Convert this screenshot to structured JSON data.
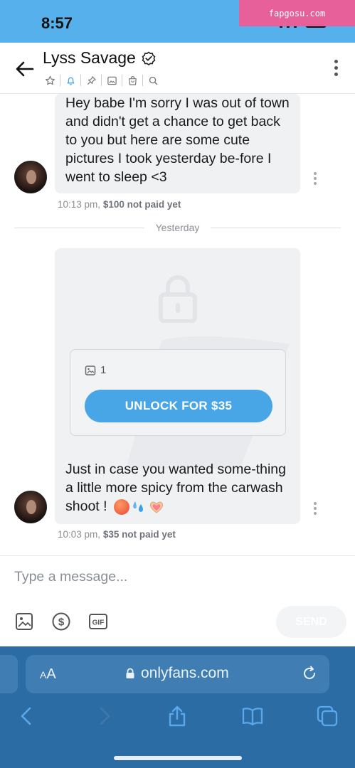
{
  "status_bar": {
    "time": "8:57",
    "battery_label": "",
    "watermark": "fapgosu.com"
  },
  "header": {
    "name": "Lyss Savage",
    "verified": true
  },
  "messages": [
    {
      "text": "Hey babe I'm sorry I was out of town and didn't get a chance to get back to you but here are some cute pictures I took yesterday be-fore I went to sleep <3",
      "time": "10:13 pm,",
      "price_status": "$100 not paid yet"
    }
  ],
  "date_divider": "Yesterday",
  "media_message": {
    "media_count": "1",
    "unlock_label": "UNLOCK FOR $35",
    "text": "Just in case you wanted some-thing a little more spicy from the carwash shoot !",
    "emojis": [
      "hot-face-emoji",
      "sweat-droplets-emoji",
      "heart-hands-emoji"
    ],
    "time": "10:03 pm,",
    "price_status": "$35 not paid yet"
  },
  "composer": {
    "placeholder": "Type a message...",
    "send_label": "SEND"
  },
  "browser": {
    "aa_label": "AA",
    "url": "onlyfans.com"
  },
  "colors": {
    "accent": "#48a6e6",
    "status_bar": "#56b0ec",
    "safari": "#2b6ca5"
  }
}
